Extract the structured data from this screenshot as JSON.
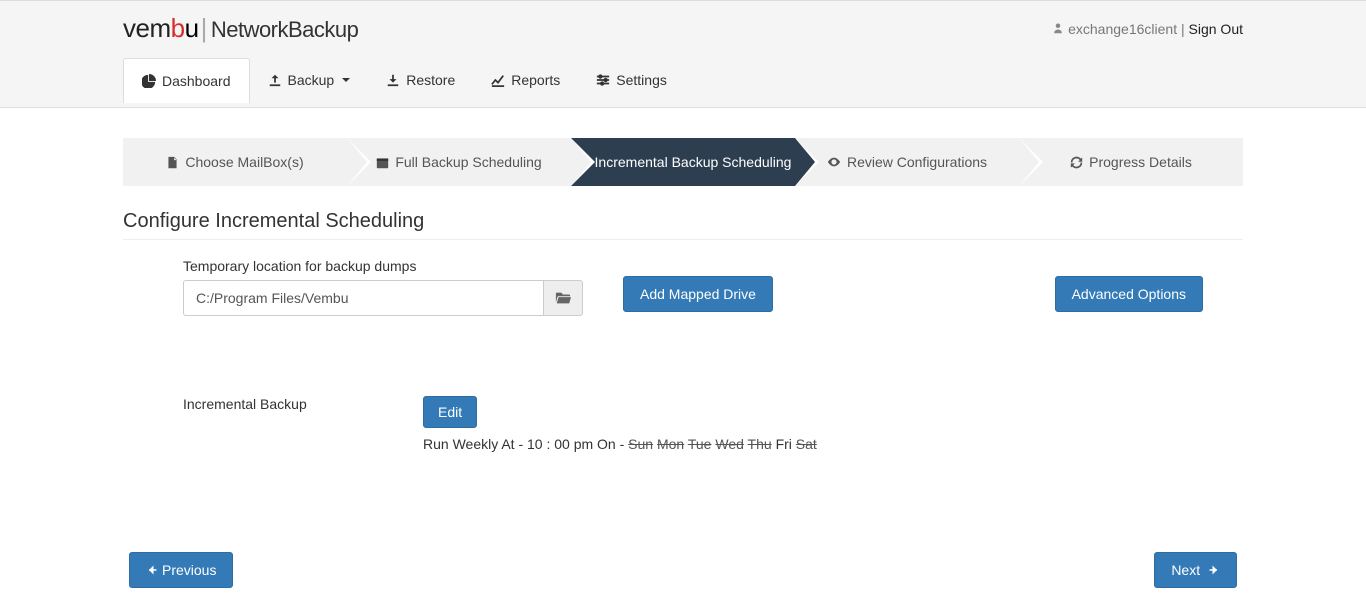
{
  "header": {
    "logo_vm": "vem",
    "logo_b": "b",
    "logo_u": "u",
    "logo_sep": "|",
    "product": "NetworkBackup",
    "username": "exchange16client",
    "user_sep": " | ",
    "signout": "Sign Out"
  },
  "nav": {
    "dashboard": "Dashboard",
    "backup": "Backup",
    "restore": "Restore",
    "reports": "Reports",
    "settings": "Settings"
  },
  "steps": {
    "s1": "Choose MailBox(s)",
    "s2": "Full Backup Scheduling",
    "s3": "Incremental Backup Scheduling",
    "s4": "Review Configurations",
    "s5": "Progress Details"
  },
  "section": {
    "title": "Configure Incremental Scheduling"
  },
  "temp": {
    "label": "Temporary location for backup dumps",
    "value": "C:/Program Files/Vembu"
  },
  "buttons": {
    "add_mapped_drive": "Add Mapped Drive",
    "advanced_options": "Advanced Options",
    "edit": "Edit",
    "previous": "Previous",
    "next": "Next"
  },
  "incremental": {
    "label": "Incremental Backup",
    "schedule_prefix": "Run Weekly At - 10 : 00 pm On - ",
    "days": [
      {
        "name": "Sun",
        "enabled": false
      },
      {
        "name": "Mon",
        "enabled": false
      },
      {
        "name": "Tue",
        "enabled": false
      },
      {
        "name": "Wed",
        "enabled": false
      },
      {
        "name": "Thu",
        "enabled": false
      },
      {
        "name": "Fri",
        "enabled": true
      },
      {
        "name": "Sat",
        "enabled": false
      }
    ]
  }
}
